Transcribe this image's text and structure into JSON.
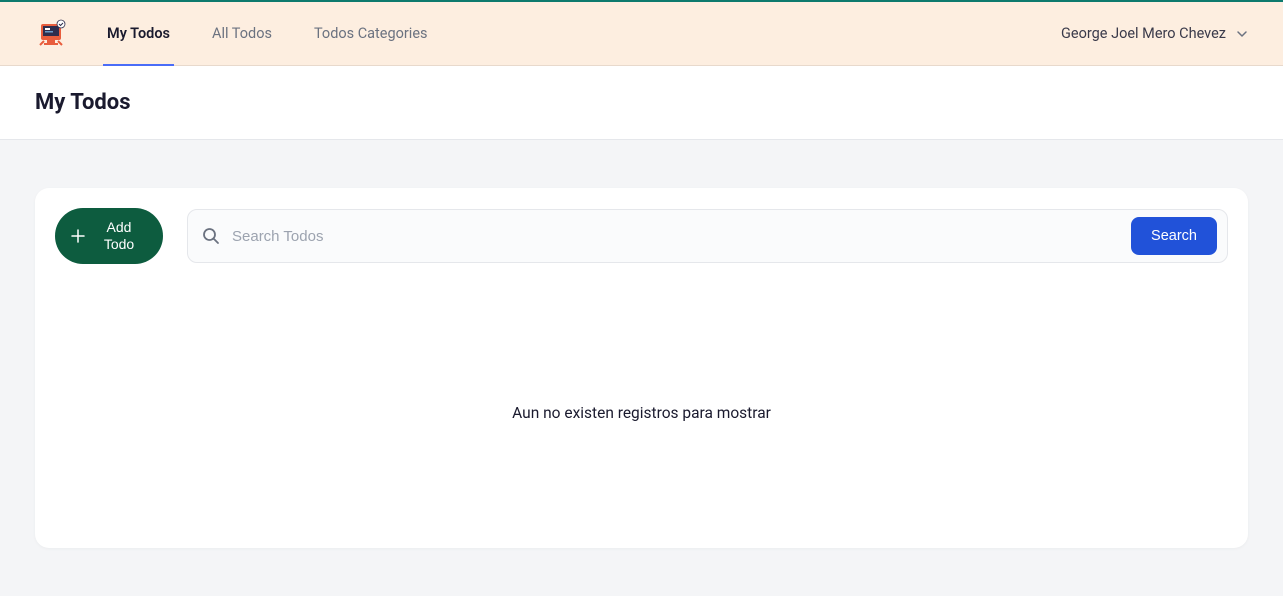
{
  "nav": {
    "tabs": [
      {
        "label": "My Todos",
        "active": true
      },
      {
        "label": "All Todos",
        "active": false
      },
      {
        "label": "Todos Categories",
        "active": false
      }
    ],
    "user_name": "George Joel Mero Chevez"
  },
  "page": {
    "title": "My Todos"
  },
  "toolbar": {
    "add_button_label": "Add Todo",
    "search_placeholder": "Search Todos",
    "search_button_label": "Search"
  },
  "content": {
    "empty_message": "Aun no existen registros para mostrar"
  }
}
